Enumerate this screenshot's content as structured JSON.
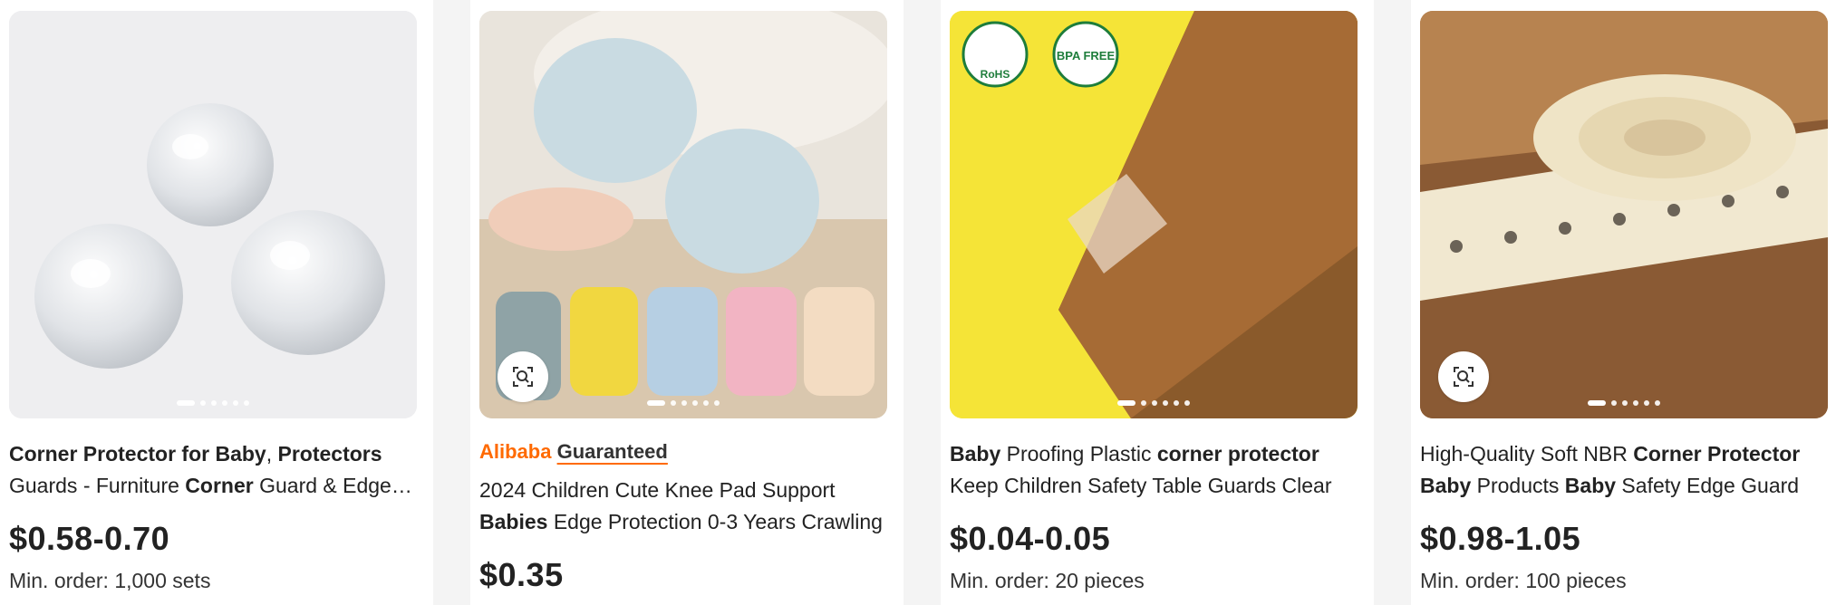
{
  "cards": [
    {
      "title_parts": [
        {
          "t": "Corner Protector for Baby",
          "b": true
        },
        {
          "t": ", ",
          "b": false
        },
        {
          "t": "Protectors",
          "b": true
        },
        {
          "t": " Guards - Furniture ",
          "b": false
        },
        {
          "t": "Corner",
          "b": true
        },
        {
          "t": " Guard & Edge Protectors",
          "b": false
        }
      ],
      "price": "$0.58-0.70",
      "moq": "Min. order: 1,000 sets",
      "dot_count": 6
    },
    {
      "badge": {
        "brand": "Alibaba",
        "word": "Guaranteed"
      },
      "title_parts": [
        {
          "t": "2024 Children Cute Knee Pad Support ",
          "b": false
        },
        {
          "t": "Babies",
          "b": true
        },
        {
          "t": " Edge Protection 0-3 Years Crawling",
          "b": false
        }
      ],
      "price": "$0.35",
      "dot_count": 6,
      "image_search_icon": "image-search-icon"
    },
    {
      "title_parts": [
        {
          "t": "Baby",
          "b": true
        },
        {
          "t": " Proofing Plastic ",
          "b": false
        },
        {
          "t": "corner protector",
          "b": true
        },
        {
          "t": " Keep Children Safety Table Guards Clear",
          "b": false
        }
      ],
      "price": "$0.04-0.05",
      "moq": "Min. order: 20 pieces",
      "dot_count": 6,
      "logos": [
        "RoHS",
        "BPA FREE"
      ]
    },
    {
      "title_parts": [
        {
          "t": "High-Quality Soft NBR ",
          "b": false
        },
        {
          "t": "Corner Protector Baby",
          "b": true
        },
        {
          "t": " Products ",
          "b": false
        },
        {
          "t": "Baby",
          "b": true
        },
        {
          "t": " Safety Edge Guard",
          "b": false
        }
      ],
      "price": "$0.98-1.05",
      "moq": "Min. order: 100 pieces",
      "dot_count": 6,
      "image_search_icon": "image-search-icon"
    }
  ]
}
